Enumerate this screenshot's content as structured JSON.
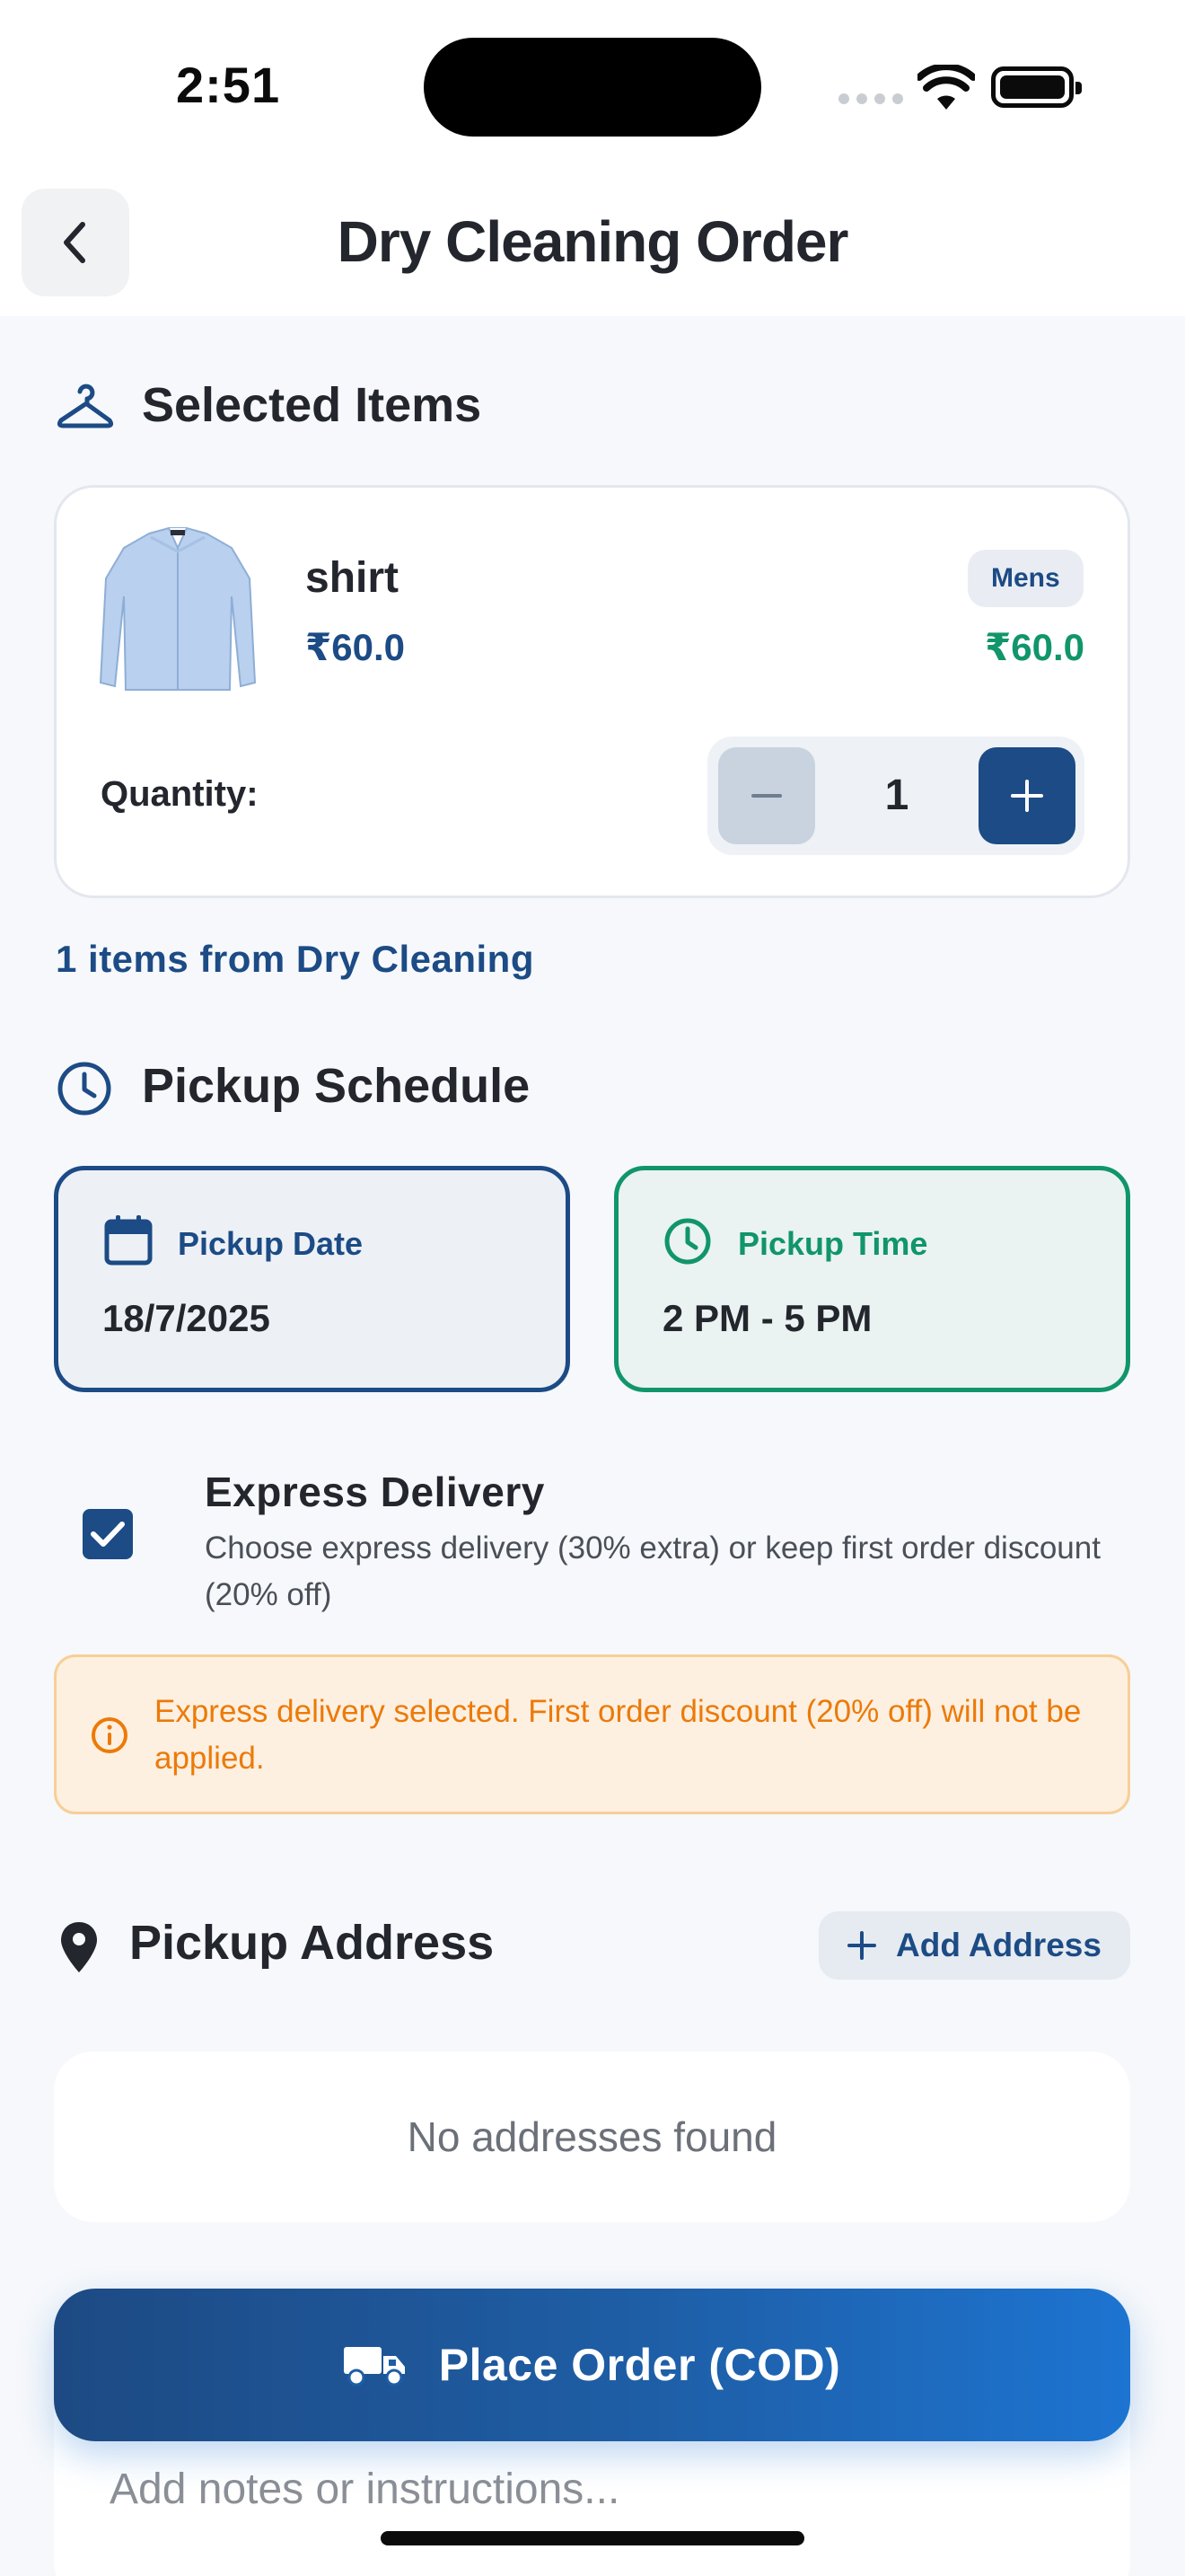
{
  "status_bar": {
    "time": "2:51"
  },
  "header": {
    "title": "Dry Cleaning Order",
    "back_icon": "chevron-left-icon"
  },
  "selected_items": {
    "heading": "Selected Items",
    "icon": "hanger-icon",
    "items": [
      {
        "name": "shirt",
        "unit_price": "₹60.0",
        "category_badge": "Mens",
        "total_price": "₹60.0",
        "quantity_label": "Quantity:",
        "quantity": "1"
      }
    ],
    "summary": "1 items from Dry Cleaning"
  },
  "pickup_schedule": {
    "heading": "Pickup Schedule",
    "icon": "clock-icon",
    "date": {
      "label": "Pickup Date",
      "value": "18/7/2025",
      "icon": "calendar-icon"
    },
    "time": {
      "label": "Pickup Time",
      "value": "2 PM - 5 PM",
      "icon": "clock-icon"
    }
  },
  "express": {
    "checked": true,
    "title": "Express Delivery",
    "description": "Choose express delivery (30% extra) or keep first order discount (20% off)",
    "notice": "Express delivery selected. First order discount (20% off) will not be applied."
  },
  "pickup_address": {
    "heading": "Pickup Address",
    "icon": "location-pin-icon",
    "add_label": "Add Address",
    "empty_text": "No addresses found"
  },
  "notes": {
    "placeholder": "Add notes or instructions..."
  },
  "place_order": {
    "label": "Place Order (COD)",
    "icon": "truck-icon"
  },
  "colors": {
    "primary": "#1c4b85",
    "success": "#11956a",
    "warning": "#ec7a09",
    "background": "#f6f8fb"
  }
}
